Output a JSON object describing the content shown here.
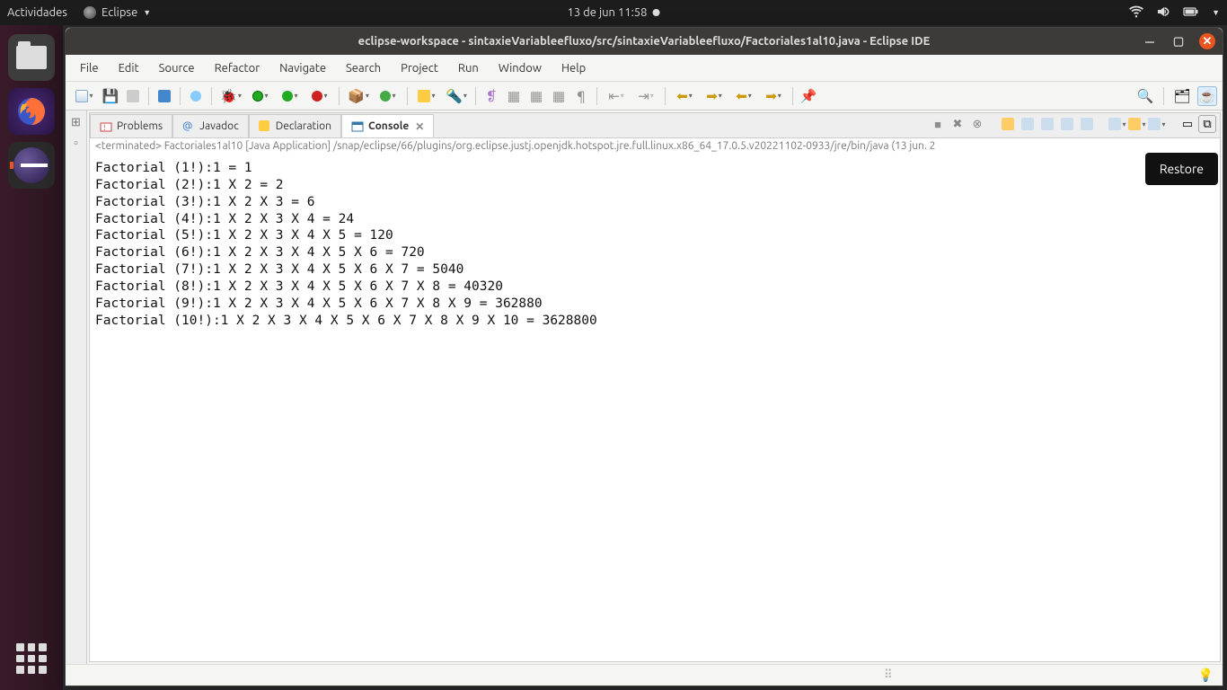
{
  "sysbar": {
    "activities": "Actividades",
    "app_name": "Eclipse",
    "datetime": "13 de jun  11:58"
  },
  "window": {
    "title": "eclipse-workspace - sintaxieVariableefluxo/src/sintaxieVariableefluxo/Factoriales1al10.java - Eclipse IDE"
  },
  "menu": {
    "file": "File",
    "edit": "Edit",
    "source": "Source",
    "refactor": "Refactor",
    "navigate": "Navigate",
    "search": "Search",
    "project": "Project",
    "run": "Run",
    "window": "Window",
    "help": "Help"
  },
  "tabs": {
    "problems": "Problems",
    "javadoc": "Javadoc",
    "declaration": "Declaration",
    "console": "Console"
  },
  "consolehdr": "<terminated> Factoriales1al10 [Java Application] /snap/eclipse/66/plugins/org.eclipse.justj.openjdk.hotspot.jre.full.linux.x86_64_17.0.5.v20221102-0933/jre/bin/java  (13 jun. 2",
  "console_lines": [
    "Factorial (1!):1 = 1",
    "Factorial (2!):1 X 2 = 2",
    "Factorial (3!):1 X 2 X 3 = 6",
    "Factorial (4!):1 X 2 X 3 X 4 = 24",
    "Factorial (5!):1 X 2 X 3 X 4 X 5 = 120",
    "Factorial (6!):1 X 2 X 3 X 4 X 5 X 6 = 720",
    "Factorial (7!):1 X 2 X 3 X 4 X 5 X 6 X 7 = 5040",
    "Factorial (8!):1 X 2 X 3 X 4 X 5 X 6 X 7 X 8 = 40320",
    "Factorial (9!):1 X 2 X 3 X 4 X 5 X 6 X 7 X 8 X 9 = 362880",
    "Factorial (10!):1 X 2 X 3 X 4 X 5 X 6 X 7 X 8 X 9 X 10 = 3628800"
  ],
  "tooltip": "Restore"
}
